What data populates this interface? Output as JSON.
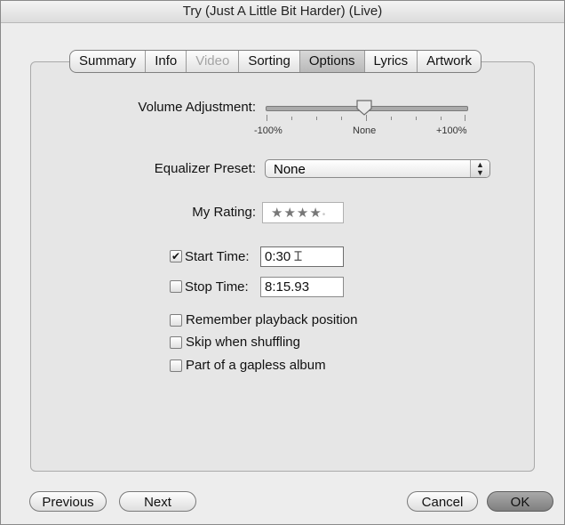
{
  "window": {
    "title": "Try (Just A Little Bit Harder) (Live)"
  },
  "tabs": [
    {
      "label": "Summary",
      "state": "normal"
    },
    {
      "label": "Info",
      "state": "normal"
    },
    {
      "label": "Video",
      "state": "disabled"
    },
    {
      "label": "Sorting",
      "state": "normal"
    },
    {
      "label": "Options",
      "state": "selected"
    },
    {
      "label": "Lyrics",
      "state": "normal"
    },
    {
      "label": "Artwork",
      "state": "normal"
    }
  ],
  "volume": {
    "label": "Volume Adjustment:",
    "min_label": "-100%",
    "mid_label": "None",
    "max_label": "+100%",
    "value": "None"
  },
  "equalizer": {
    "label": "Equalizer Preset:",
    "value": "None"
  },
  "rating": {
    "label": "My Rating:",
    "filled": "★★★★",
    "empty": "•",
    "value": 4
  },
  "start_time": {
    "label": "Start Time:",
    "value": "0:30",
    "checked": true,
    "check_glyph": "✔"
  },
  "stop_time": {
    "label": "Stop Time:",
    "value": "8:15.93",
    "checked": false
  },
  "options": {
    "remember": {
      "label": "Remember playback position",
      "checked": false
    },
    "skip": {
      "label": "Skip when shuffling",
      "checked": false
    },
    "gapless": {
      "label": "Part of a gapless album",
      "checked": false
    }
  },
  "buttons": {
    "previous": "Previous",
    "next": "Next",
    "cancel": "Cancel",
    "ok": "OK"
  }
}
